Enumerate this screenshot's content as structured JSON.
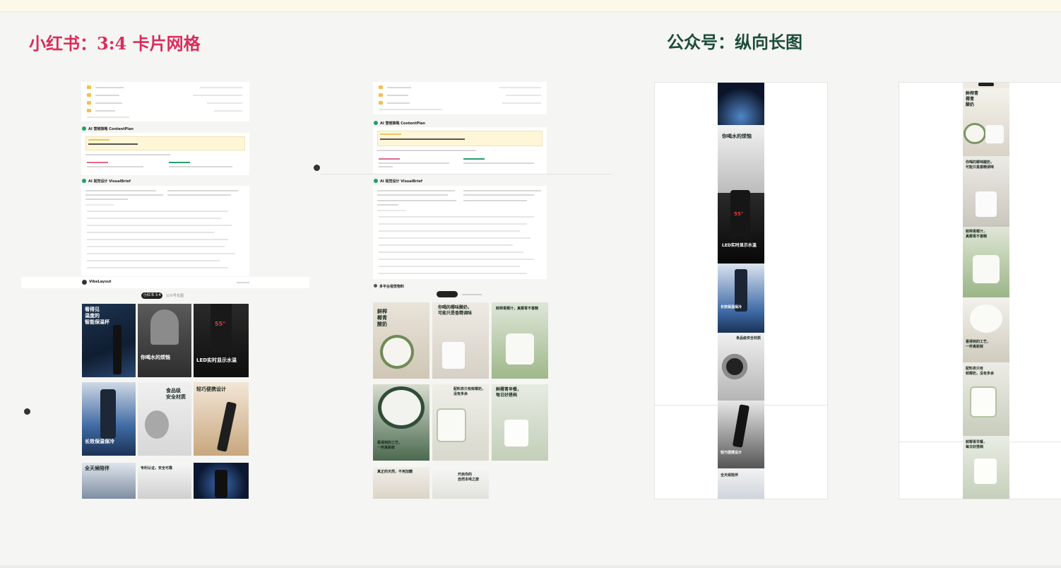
{
  "sections": {
    "xhs_title": "小红书：3:4 卡片网格",
    "gzh_title": "公众号：纵向长图"
  },
  "left_panel": {
    "content_plan_heading": "AI 营销策略 ContentPlan",
    "visual_brief_heading": "AI 视觉设计 VisualBrief",
    "app_name": "VibeLayout",
    "tab_xhs": "小红书 3:4",
    "tab_gzh": "公众号长图",
    "cards": [
      {
        "caption": "看得见\n温度的\n智能保温杯"
      },
      {
        "caption": "你喝水的烦恼"
      },
      {
        "caption": "LED实时显示水温"
      },
      {
        "caption": "长效保温保冷"
      },
      {
        "caption": "食品级\n安全材质"
      },
      {
        "caption": "轻巧便携设计"
      },
      {
        "caption": "全天候陪伴"
      },
      {
        "caption": "专利认证，安全可靠"
      },
      {
        "caption": ""
      }
    ]
  },
  "mid_panel": {
    "content_plan_heading": "AI 营销策略 ContentPlan",
    "visual_brief_heading": "AI 视觉设计 VisualBrief",
    "multi_platform_heading": "多平台视觉物料",
    "cards": [
      {
        "caption": "鲜榨\n椰青\n酸奶"
      },
      {
        "caption": "你喝的椰味酸奶，\n可能只是香精调味"
      },
      {
        "caption": "鲜榨青椰汁，真椰青不香精"
      },
      {
        "caption": "看得到的工艺，\n一杯真新鲜"
      },
      {
        "caption": "配料表只有鲜椰奶，\n没有多余"
      },
      {
        "caption": "鲜椰青早餐，\n每日好搭档"
      },
      {
        "caption": "真正的天然，不用加糖"
      },
      {
        "caption": "开启你的\n自然本味之旅"
      }
    ]
  },
  "long_images": {
    "cup": [
      "你喝水的烦恼",
      "LED实时显示水温",
      "长效保温保冷",
      "食品级安全材质",
      "轻巧便携设计",
      "全天候陪伴"
    ],
    "yogurt": [
      "鲜榨青\n椰青\n酸奶",
      "你喝的椰味酸奶，\n可能只是香精调味",
      "鲜榨青椰汁，\n真椰青不香精",
      "看得到的工艺，\n一杯真新鲜",
      "配料表只有\n鲜椰奶，没有多余",
      "鲜椰青早餐，\n每日好搭档"
    ]
  },
  "colors": {
    "xhs_red": "#d92d5b",
    "gzh_green": "#1d4d39",
    "topbar": "#fdf9ea",
    "background": "#f5f5f3"
  }
}
